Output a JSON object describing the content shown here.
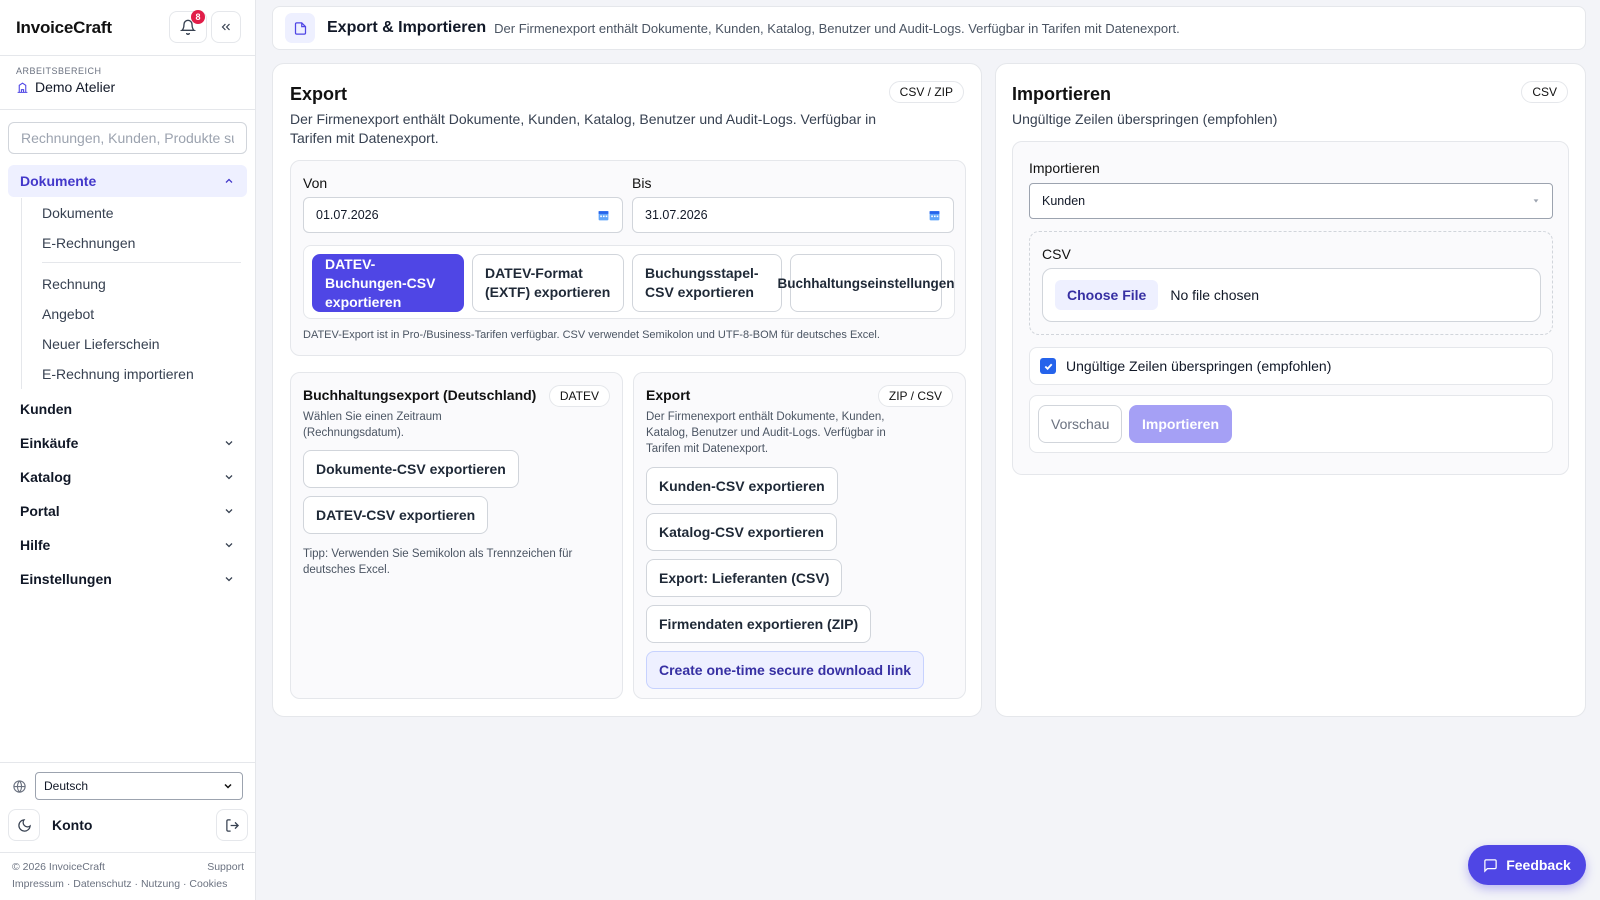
{
  "sidebar": {
    "brand": "InvoiceCraft",
    "notification_count": "8",
    "workspace_label": "ARBEITSBEREICH",
    "workspace_name": "Demo Atelier",
    "search_placeholder": "Rechnungen, Kunden, Produkte su",
    "active_section": "Dokumente",
    "sub_items_top": [
      "Dokumente",
      "E-Rechnungen"
    ],
    "sub_items_bottom": [
      "Rechnung",
      "Angebot",
      "Neuer Lieferschein",
      "E-Rechnung importieren"
    ],
    "nav_items": [
      "Kunden",
      "Einkäufe",
      "Katalog",
      "Portal",
      "Hilfe",
      "Einstellungen"
    ],
    "language": "Deutsch",
    "account_label": "Konto",
    "footer": {
      "copyright": "© 2026 InvoiceCraft",
      "support": "Support",
      "links": "Impressum · Datenschutz · Nutzung · Cookies"
    }
  },
  "header": {
    "title": "Export & Importieren",
    "description": "Der Firmenexport enthält Dokumente, Kunden, Katalog, Benutzer und Audit-Logs. Verfügbar in Tarifen mit Datenexport."
  },
  "export": {
    "title": "Export",
    "badge": "CSV / ZIP",
    "description": "Der Firmenexport enthält Dokumente, Kunden, Katalog, Benutzer und Audit-Logs. Verfügbar in Tarifen mit Datenexport.",
    "from_label": "Von",
    "from_value": "01.07.2026",
    "to_label": "Bis",
    "to_value": "31.07.2026",
    "datev_buttons": [
      "DATEV-Buchungen-CSV exportieren",
      "DATEV-Format (EXTF) exportieren",
      "Buchungsstapel-CSV exportieren",
      "Buchhaltungseinstellungen"
    ],
    "datev_note": "DATEV-Export ist in Pro-/Business-Tarifen verfügbar. CSV verwendet Semikolon und UTF-8-BOM für deutsches Excel.",
    "accounting": {
      "title": "Buchhaltungsexport (Deutschland)",
      "badge": "DATEV",
      "description": "Wählen Sie einen Zeitraum (Rechnungsdatum).",
      "buttons": [
        "Dokumente-CSV exportieren",
        "DATEV-CSV exportieren"
      ],
      "tip": "Tipp: Verwenden Sie Semikolon als Trennzeichen für deutsches Excel."
    },
    "company": {
      "title": "Export",
      "badge": "ZIP / CSV",
      "description": "Der Firmenexport enthält Dokumente, Kunden, Katalog, Benutzer und Audit-Logs. Verfügbar in Tarifen mit Datenexport.",
      "buttons": [
        "Kunden-CSV exportieren",
        "Katalog-CSV exportieren",
        "Export: Lieferanten (CSV)",
        "Firmendaten exportieren (ZIP)"
      ],
      "link_button": "Create one-time secure download link"
    }
  },
  "import": {
    "title": "Importieren",
    "badge": "CSV",
    "description": "Ungültige Zeilen überspringen (empfohlen)",
    "type_label": "Importieren",
    "type_value": "Kunden",
    "csv_label": "CSV",
    "choose_file": "Choose File",
    "no_file": "No file chosen",
    "skip_invalid": "Ungültige Zeilen überspringen (empfohlen)",
    "preview": "Vorschau",
    "import_button": "Importieren"
  },
  "feedback": "Feedback",
  "colors": {
    "accent": "#4f46e5",
    "accent_soft": "#eef0ff",
    "badge_red": "#e11d48"
  }
}
